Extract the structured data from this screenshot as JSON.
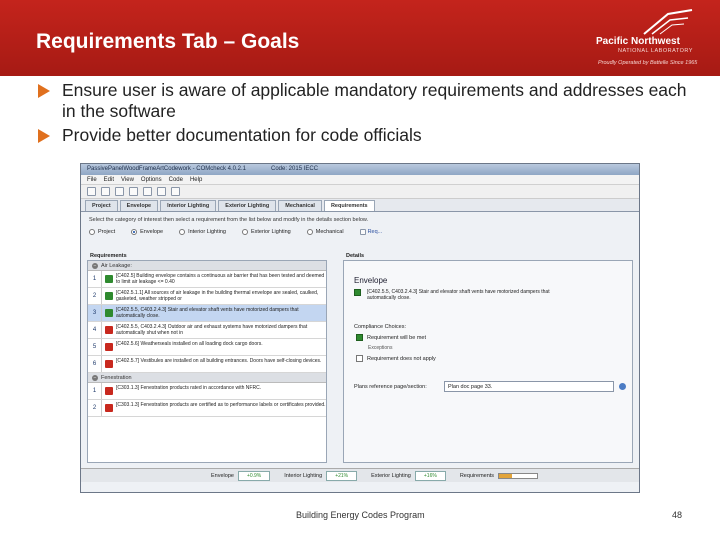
{
  "header": {
    "title": "Requirements Tab – Goals",
    "logo_name": "Pacific Northwest",
    "logo_sub": "NATIONAL LABORATORY",
    "logo_tagline": "Proudly Operated by Battelle Since 1965",
    "background_color": "#b01f17"
  },
  "bullets": [
    "Ensure user is aware of applicable mandatory requirements and addresses each in the software",
    "Provide better documentation for code officials"
  ],
  "app": {
    "window_title": "PassivePanelWoodFrameArtCodework - COMcheck 4.0.2.1",
    "code_label": "Code: 2015 IECC",
    "menu": [
      "File",
      "Edit",
      "View",
      "Options",
      "Code",
      "Help"
    ],
    "tabs": [
      "Project",
      "Envelope",
      "Interior Lighting",
      "Exterior Lighting",
      "Mechanical",
      "Requirements"
    ],
    "active_tab": "Requirements",
    "instruction": "Select the category of interest then select a requirement from the list below and modify in the details section below.",
    "categories": [
      "Project",
      "Envelope",
      "Interior Lighting",
      "Exterior Lighting",
      "Mechanical"
    ],
    "selected_category": "Envelope",
    "help_link": "Req...",
    "requirements_label": "Requirements",
    "details_label": "Details",
    "groups": [
      {
        "name": "Air Leakage:",
        "items": [
          {
            "num": "1",
            "status": "ok",
            "text": "[C402.5] Building envelope contains a continuous air barrier that has been tested and deemed to limit air leakage <= 0.40"
          },
          {
            "num": "2",
            "status": "ok",
            "text": "[C402.5.1.1] All sources of air leakage in the building thermal envelope are sealed, caulked, gasketed, weather stripped or"
          },
          {
            "num": "3",
            "status": "ok",
            "text": "[C402.5.5, C403.2.4.3] Stair and elevator shaft vents have motorized dampers that automatically close.",
            "selected": true
          },
          {
            "num": "4",
            "status": "bad",
            "text": "[C402.5.5, C403.2.4.3] Outdoor air and exhaust systems have motorized dampers that automatically shut when not in"
          },
          {
            "num": "5",
            "status": "bad",
            "text": "[C402.5.6] Weatherseals installed on all loading dock cargo doors."
          },
          {
            "num": "6",
            "status": "bad",
            "text": "[C402.5.7] Vestibules are installed on all building entrances. Doors have self-closing devices."
          }
        ]
      },
      {
        "name": "Fenestration",
        "items": [
          {
            "num": "1",
            "status": "bad",
            "text": "[C303.1.3] Fenestration products rated in accordance with NFRC."
          },
          {
            "num": "2",
            "status": "bad",
            "text": "[C303.1.3] Fenestration products are certified as to performance labels or certificates provided."
          }
        ]
      }
    ],
    "details": {
      "section_title": "Envelope",
      "requirement_text": "[C402.5.5, C403.2.4.3] Stair and elevator shaft vents have motorized dampers that automatically close.",
      "compliance_label": "Compliance Choices:",
      "choice_met": "Requirement will be met",
      "exceptions_label": "Exceptions",
      "choice_not_met": "Requirement does not apply",
      "plans_label": "Plans reference page/section:",
      "plans_value": "Plan doc page 33."
    },
    "status_bar": {
      "envelope_label": "Envelope",
      "envelope_value": "+0.9%",
      "interior_label": "Interior Lighting",
      "interior_value": "+21%",
      "exterior_label": "Exterior Lighting",
      "exterior_value": "+16%",
      "requirements_label": "Requirements",
      "requirements_progress": 0.35
    }
  },
  "footer": {
    "program": "Building Energy Codes Program",
    "page": "48"
  }
}
